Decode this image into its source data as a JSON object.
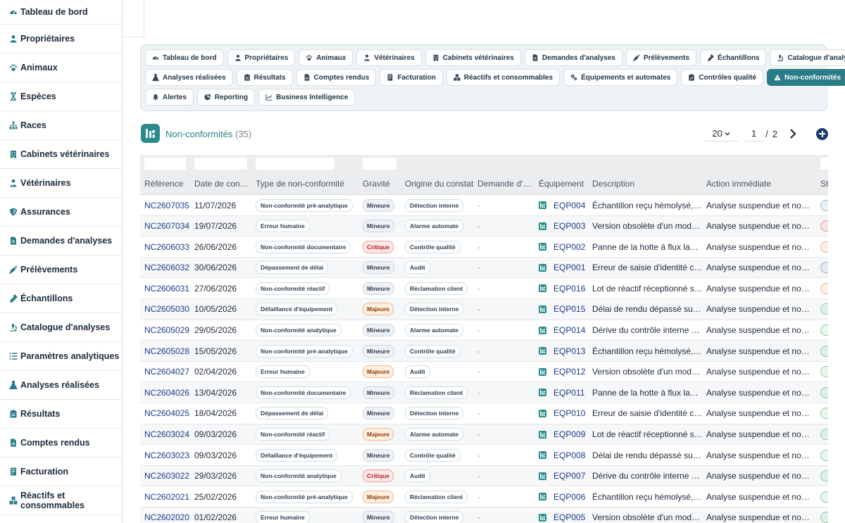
{
  "sidebar": {
    "items": [
      {
        "label": "Tableau de bord",
        "icon": "dashboard-icon"
      },
      {
        "label": "Propriétaires",
        "icon": "person-icon"
      },
      {
        "label": "Animaux",
        "icon": "paw-icon"
      },
      {
        "label": "Espèces",
        "icon": "hourglass-icon"
      },
      {
        "label": "Races",
        "icon": "hierarchy-icon"
      },
      {
        "label": "Cabinets vétérinaires",
        "icon": "building-icon"
      },
      {
        "label": "Vétérinaires",
        "icon": "doctor-icon"
      },
      {
        "label": "Assurances",
        "icon": "shield-icon"
      },
      {
        "label": "Demandes d'analyses",
        "icon": "document-icon"
      },
      {
        "label": "Prélèvements",
        "icon": "syringe-icon"
      },
      {
        "label": "Échantillons",
        "icon": "dropper-icon"
      },
      {
        "label": "Catalogue d'analyses",
        "icon": "microscope-icon"
      },
      {
        "label": "Paramètres analytiques",
        "icon": "list-icon"
      },
      {
        "label": "Analyses réalisées",
        "icon": "flask-icon"
      },
      {
        "label": "Résultats",
        "icon": "clipboard-icon"
      },
      {
        "label": "Comptes rendus",
        "icon": "report-icon"
      },
      {
        "label": "Facturation",
        "icon": "invoice-icon"
      },
      {
        "label": "Réactifs et consommables",
        "icon": "boxes-icon"
      }
    ]
  },
  "nav": {
    "rows": [
      [
        {
          "label": "Tableau de bord",
          "icon": "dashboard-icon"
        },
        {
          "label": "Propriétaires",
          "icon": "person-icon"
        },
        {
          "label": "Animaux",
          "icon": "paw-icon"
        },
        {
          "label": "Vétérinaires",
          "icon": "doctor-icon"
        },
        {
          "label": "Cabinets vétérinaires",
          "icon": "building-icon"
        },
        {
          "label": "Demandes d'analyses",
          "icon": "document-icon"
        },
        {
          "label": "Prélèvements",
          "icon": "syringe-icon"
        },
        {
          "label": "Échantillons",
          "icon": "dropper-icon"
        },
        {
          "label": "Catalogue d'analyses",
          "icon": "microscope-icon"
        }
      ],
      [
        {
          "label": "Analyses réalisées",
          "icon": "flask-icon"
        },
        {
          "label": "Résultats",
          "icon": "clipboard-icon"
        },
        {
          "label": "Comptes rendus",
          "icon": "report-icon"
        },
        {
          "label": "Facturation",
          "icon": "invoice-icon"
        },
        {
          "label": "Réactifs et consommables",
          "icon": "boxes-icon"
        },
        {
          "label": "Équipements et automates",
          "icon": "gears-icon"
        },
        {
          "label": "Contrôles qualité",
          "icon": "check-clipboard-icon"
        },
        {
          "label": "Non-conformités",
          "icon": "warning-icon",
          "active": true
        }
      ],
      [
        {
          "label": "Alertes",
          "icon": "bell-icon"
        },
        {
          "label": "Reporting",
          "icon": "pie-chart-icon"
        },
        {
          "label": "Business Intelligence",
          "icon": "line-chart-icon"
        }
      ]
    ]
  },
  "list": {
    "title": "Non-conformités",
    "count": "(35)",
    "page_size": "20",
    "current_page": "1",
    "page_separator": "/",
    "total_pages": "2"
  },
  "table": {
    "headers": [
      "Référence",
      "Date de con…",
      "Type de non-conformité",
      "Gravité",
      "Origine du constat",
      "Demande d'…",
      "Équipement",
      "Description",
      "Action immédiate",
      "St"
    ],
    "rows": [
      {
        "ref": "NC2607035",
        "date": "11/07/2026",
        "type": "Non-conformité pré-analytique",
        "grav": "Mineure",
        "origine": "Détection interne",
        "demande": "-",
        "eq": "EQP004",
        "desc": "Échantillon reçu hémolysé, r…",
        "action": "Analyse suspendue et nouv…",
        "status_color": "#9db6cf"
      },
      {
        "ref": "NC2607034",
        "date": "19/07/2026",
        "type": "Erreur humaine",
        "grav": "Mineure",
        "origine": "Alarme automate",
        "demande": "-",
        "eq": "EQP003",
        "desc": "Version obsolète d'un mode…",
        "action": "Analyse suspendue et nouv…",
        "status_color": "#f19c9c"
      },
      {
        "ref": "NC2606033",
        "date": "26/06/2026",
        "type": "Non-conformité documentaire",
        "grav": "Critique",
        "origine": "Contrôle qualité",
        "demande": "-",
        "eq": "EQP002",
        "desc": "Panne de la hotte à flux lam…",
        "action": "Analyse suspendue et nouv…",
        "status_color": "#f2b58a"
      },
      {
        "ref": "NC2606032",
        "date": "30/06/2026",
        "type": "Dépassement de délai",
        "grav": "Mineure",
        "origine": "Audit",
        "demande": "-",
        "eq": "EQP001",
        "desc": "Erreur de saisie d'identité c…",
        "action": "Analyse suspendue et nouv…",
        "status_color": "#9db6cf"
      },
      {
        "ref": "NC2606031",
        "date": "27/06/2026",
        "type": "Non-conformité réactif",
        "grav": "Mineure",
        "origine": "Réclamation client",
        "demande": "-",
        "eq": "EQP016",
        "desc": "Lot de réactif réceptionné s…",
        "action": "Analyse suspendue et nouv…",
        "status_color": "#f2b58a"
      },
      {
        "ref": "NC2605030",
        "date": "10/05/2026",
        "type": "Défaillance d'équipement",
        "grav": "Majeure",
        "origine": "Détection interne",
        "demande": "-",
        "eq": "EQP015",
        "desc": "Délai de rendu dépassé sur …",
        "action": "Analyse suspendue et nouv…",
        "status_color": "#8fcfa5"
      },
      {
        "ref": "NC2605029",
        "date": "29/05/2026",
        "type": "Non-conformité analytique",
        "grav": "Mineure",
        "origine": "Alarme automate",
        "demande": "-",
        "eq": "EQP014",
        "desc": "Dérive du contrôle interne s…",
        "action": "Analyse suspendue et nouv…",
        "status_color": "#8fcfa5"
      },
      {
        "ref": "NC2605028",
        "date": "15/05/2026",
        "type": "Non-conformité pré-analytique",
        "grav": "Mineure",
        "origine": "Contrôle qualité",
        "demande": "-",
        "eq": "EQP013",
        "desc": "Échantillon reçu hémolysé, r…",
        "action": "Analyse suspendue et nouv…",
        "status_color": "#8fcfa5"
      },
      {
        "ref": "NC2604027",
        "date": "02/04/2026",
        "type": "Erreur humaine",
        "grav": "Majeure",
        "origine": "Audit",
        "demande": "-",
        "eq": "EQP012",
        "desc": "Version obsolète d'un mode…",
        "action": "Analyse suspendue et nouv…",
        "status_color": "#8fcfa5"
      },
      {
        "ref": "NC2604026",
        "date": "13/04/2026",
        "type": "Non-conformité documentaire",
        "grav": "Mineure",
        "origine": "Réclamation client",
        "demande": "-",
        "eq": "EQP011",
        "desc": "Panne de la hotte à flux lam…",
        "action": "Analyse suspendue et nouv…",
        "status_color": "#8fcfa5"
      },
      {
        "ref": "NC2604025",
        "date": "18/04/2026",
        "type": "Dépassement de délai",
        "grav": "Mineure",
        "origine": "Détection interne",
        "demande": "-",
        "eq": "EQP010",
        "desc": "Erreur de saisie d'identité c…",
        "action": "Analyse suspendue et nouv…",
        "status_color": "#8fcfa5"
      },
      {
        "ref": "NC2603024",
        "date": "09/03/2026",
        "type": "Non-conformité réactif",
        "grav": "Majeure",
        "origine": "Alarme automate",
        "demande": "-",
        "eq": "EQP009",
        "desc": "Lot de réactif réceptionné s…",
        "action": "Analyse suspendue et nouv…",
        "status_color": "#8fcfa5"
      },
      {
        "ref": "NC2603023",
        "date": "09/03/2026",
        "type": "Défaillance d'équipement",
        "grav": "Mineure",
        "origine": "Contrôle qualité",
        "demande": "-",
        "eq": "EQP008",
        "desc": "Délai de rendu dépassé sur …",
        "action": "Analyse suspendue et nouv…",
        "status_color": "#8fcfa5"
      },
      {
        "ref": "NC2603022",
        "date": "29/03/2026",
        "type": "Non-conformité analytique",
        "grav": "Critique",
        "origine": "Audit",
        "demande": "-",
        "eq": "EQP007",
        "desc": "Dérive du contrôle interne s…",
        "action": "Analyse suspendue et nouv…",
        "status_color": "#8fcfa5"
      },
      {
        "ref": "NC2602021",
        "date": "25/02/2026",
        "type": "Non-conformité pré-analytique",
        "grav": "Majeure",
        "origine": "Réclamation client",
        "demande": "-",
        "eq": "EQP006",
        "desc": "Échantillon reçu hémolysé, r…",
        "action": "Analyse suspendue et nouv…",
        "status_color": "#8fcfa5"
      },
      {
        "ref": "NC2602020",
        "date": "01/02/2026",
        "type": "Erreur humaine",
        "grav": "Mineure",
        "origine": "Détection interne",
        "demande": "-",
        "eq": "EQP005",
        "desc": "Version obsolète d'un mode…",
        "action": "Analyse suspendue et nouv…",
        "status_color": "#8fcfa5"
      }
    ]
  },
  "colors": {
    "accent": "#2a7c86",
    "link": "#1e3a8a",
    "add_button": "#1b3b6f"
  }
}
